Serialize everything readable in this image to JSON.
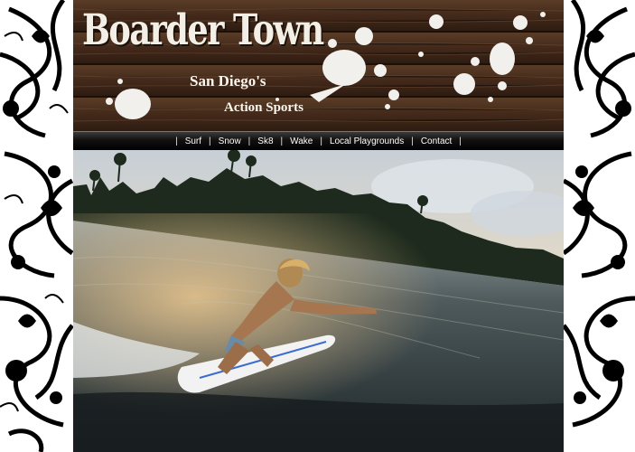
{
  "header": {
    "brand": "Boarder Town",
    "tagline_line1": "San Diego's",
    "tagline_line2": "Action Sports"
  },
  "nav": {
    "separator": "|",
    "items": [
      {
        "label": "Surf"
      },
      {
        "label": "Snow"
      },
      {
        "label": "Sk8"
      },
      {
        "label": "Wake"
      },
      {
        "label": "Local Playgrounds"
      },
      {
        "label": "Contact"
      }
    ]
  },
  "colors": {
    "wood": "#4a3220",
    "nav_bar": "#111111",
    "text_light": "#fbf6ee",
    "ornament": "#000000"
  },
  "icons": {
    "side_ornament": "floral-swirl-pattern",
    "header_splatter": "paint-splatter"
  }
}
